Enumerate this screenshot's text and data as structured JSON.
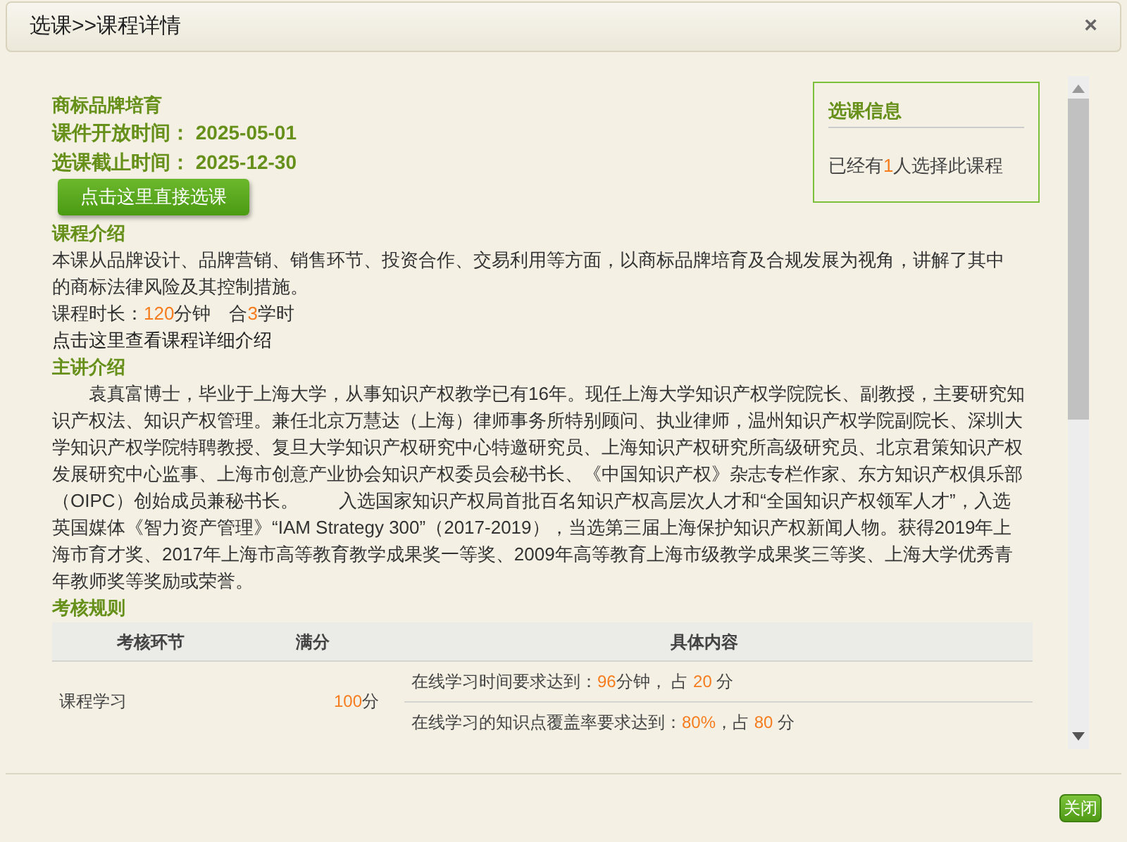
{
  "window": {
    "title": "选课>>课程详情",
    "close": "×"
  },
  "course": {
    "name": "商标品牌培育",
    "open_label": "课件开放时间：",
    "open_date": "2025-05-01",
    "deadline_label": "选课截止时间：",
    "deadline_date": "2025-12-30",
    "enroll_button": "点击这里直接选课"
  },
  "info_box": {
    "title": "选课信息",
    "text": [
      {
        "text": "已经有",
        "highlight": false
      },
      {
        "text": "1",
        "highlight": true
      },
      {
        "text": "人选择此课程",
        "highlight": false
      }
    ]
  },
  "intro": {
    "heading": "课程介绍",
    "text": "本课从品牌设计、品牌营销、销售环节、投资合作、交易利用等方面，以商标品牌培育及合规发展为视角，讲解了其中的商标法律风险及其控制措施。",
    "duration": [
      {
        "text": "课程时长：",
        "highlight": false
      },
      {
        "text": "120",
        "highlight": true
      },
      {
        "text": "分钟　合",
        "highlight": false
      },
      {
        "text": "3",
        "highlight": true
      },
      {
        "text": "学时",
        "highlight": false
      }
    ],
    "detail_link": "点击这里查看课程详细介绍"
  },
  "lecturer": {
    "heading": "主讲介绍",
    "text": "袁真富博士，毕业于上海大学，从事知识产权教学已有16年。现任上海大学知识产权学院院长、副教授，主要研究知识产权法、知识产权管理。兼任北京万慧达（上海）律师事务所特别顾问、执业律师，温州知识产权学院副院长、深圳大学知识产权学院特聘教授、复旦大学知识产权研究中心特邀研究员、上海知识产权研究所高级研究员、北京君策知识产权发展研究中心监事、上海市创意产业协会知识产权委员会秘书长、《中国知识产权》杂志专栏作家、东方知识产权俱乐部（OIPC）创始成员兼秘书长。        入选国家知识产权局首批百名知识产权高层次人才和“全国知识产权领军人才”，入选英国媒体《智力资产管理》“IAM Strategy 300”（2017-2019），当选第三届上海保护知识产权新闻人物。获得2019年上海市育才奖、2017年上海市高等教育教学成果奖一等奖、2009年高等教育上海市级教学成果奖三等奖、上海大学优秀青年教师奖等奖励或荣誉。"
  },
  "assessment": {
    "heading": "考核规则",
    "columns": [
      "考核环节",
      "满分",
      "具体内容"
    ],
    "rows": [
      {
        "stage": "课程学习",
        "score": [
          {
            "text": "100",
            "highlight": true
          },
          {
            "text": "分",
            "highlight": false
          }
        ],
        "items": [
          [
            {
              "text": "在线学习时间要求达到：",
              "highlight": false
            },
            {
              "text": "96",
              "highlight": true
            },
            {
              "text": "分钟， 占 ",
              "highlight": false
            },
            {
              "text": "20",
              "highlight": true
            },
            {
              "text": " 分",
              "highlight": false
            }
          ],
          [
            {
              "text": "在线学习的知识点覆盖率要求达到：",
              "highlight": false
            },
            {
              "text": "80%",
              "highlight": true
            },
            {
              "text": "，占 ",
              "highlight": false
            },
            {
              "text": "80",
              "highlight": true
            },
            {
              "text": " 分",
              "highlight": false
            }
          ]
        ]
      }
    ]
  },
  "footer": {
    "close_button": "关闭"
  }
}
